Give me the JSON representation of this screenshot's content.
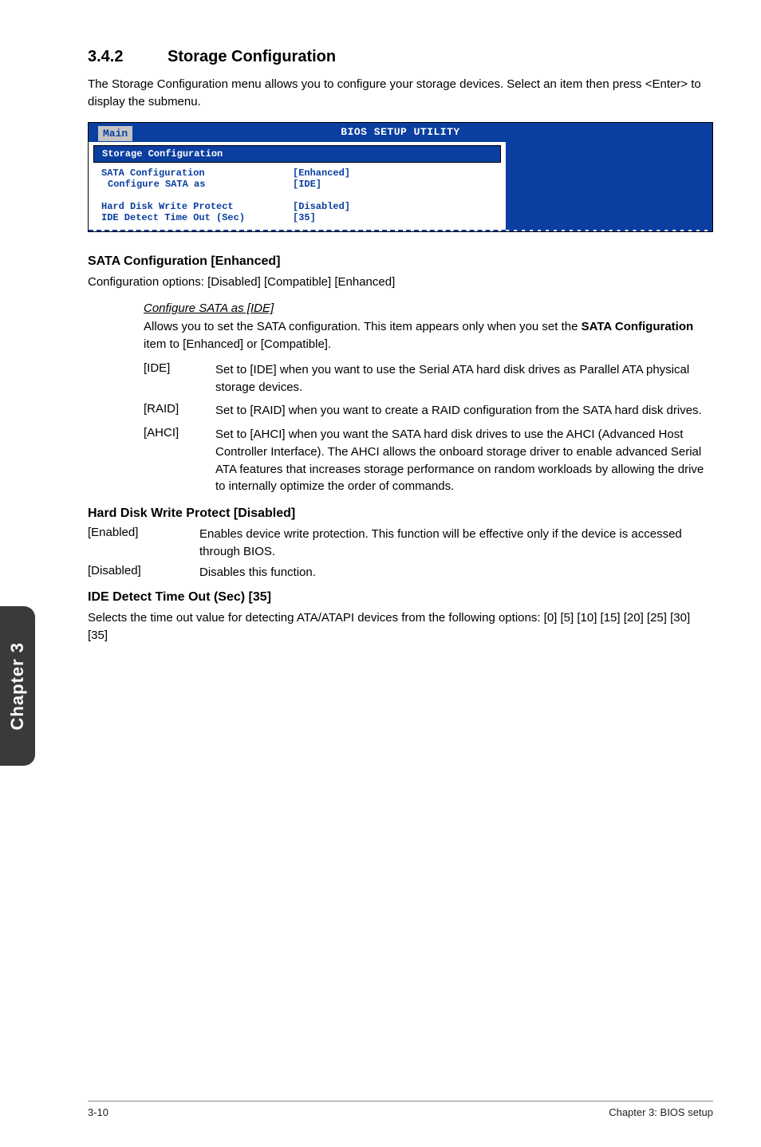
{
  "section": {
    "number": "3.4.2",
    "title": "Storage Configuration"
  },
  "intro": "The Storage Configuration menu allows you to configure your storage devices. Select an item then press <Enter> to display the submenu.",
  "bios": {
    "utility_title": "BIOS SETUP UTILITY",
    "tab": "Main",
    "subheader": "Storage Configuration",
    "rows": [
      {
        "label": "SATA Configuration",
        "value": "[Enhanced]",
        "indent": false
      },
      {
        "label": "Configure SATA as",
        "value": "[IDE]",
        "indent": true
      }
    ],
    "rows2": [
      {
        "label": "Hard Disk Write Protect",
        "value": "[Disabled]"
      },
      {
        "label": "IDE Detect Time Out (Sec)",
        "value": "[35]"
      }
    ]
  },
  "sata_cfg": {
    "heading": "SATA Configuration [Enhanced]",
    "options_line": "Configuration options: [Disabled] [Compatible] [Enhanced]",
    "sub_heading": "Configure SATA as [IDE]",
    "sub_desc1": "Allows you to set the SATA configuration. This item appears only when you set the ",
    "sub_desc_bold": "SATA Configuration",
    "sub_desc2": " item to [Enhanced] or [Compatible].",
    "items": [
      {
        "key": "[IDE]",
        "text": "Set to [IDE] when you want to use the Serial ATA hard disk drives as Parallel ATA physical storage devices."
      },
      {
        "key": "[RAID]",
        "text": "Set to [RAID] when you want to create a RAID configuration from the SATA hard disk drives."
      },
      {
        "key": "[AHCI]",
        "text": "Set to [AHCI] when you want the SATA hard disk drives to use the AHCI (Advanced Host Controller Interface). The AHCI allows the onboard storage driver to enable advanced Serial ATA features that increases storage performance on random workloads by allowing the drive to internally optimize the order of commands."
      }
    ]
  },
  "hdwp": {
    "heading": "Hard Disk Write Protect [Disabled]",
    "items": [
      {
        "key": "[Enabled]",
        "text": "Enables device write protection. This function will be effective only if the device is accessed through BIOS."
      },
      {
        "key": "[Disabled]",
        "text": "Disables this function."
      }
    ]
  },
  "ide_detect": {
    "heading": "IDE Detect Time Out (Sec) [35]",
    "text": "Selects the time out value for detecting ATA/ATAPI devices from the following options: [0] [5] [10] [15] [20] [25] [30] [35]"
  },
  "side_tab": "Chapter 3",
  "footer": {
    "left": "3-10",
    "right": "Chapter 3: BIOS setup"
  }
}
